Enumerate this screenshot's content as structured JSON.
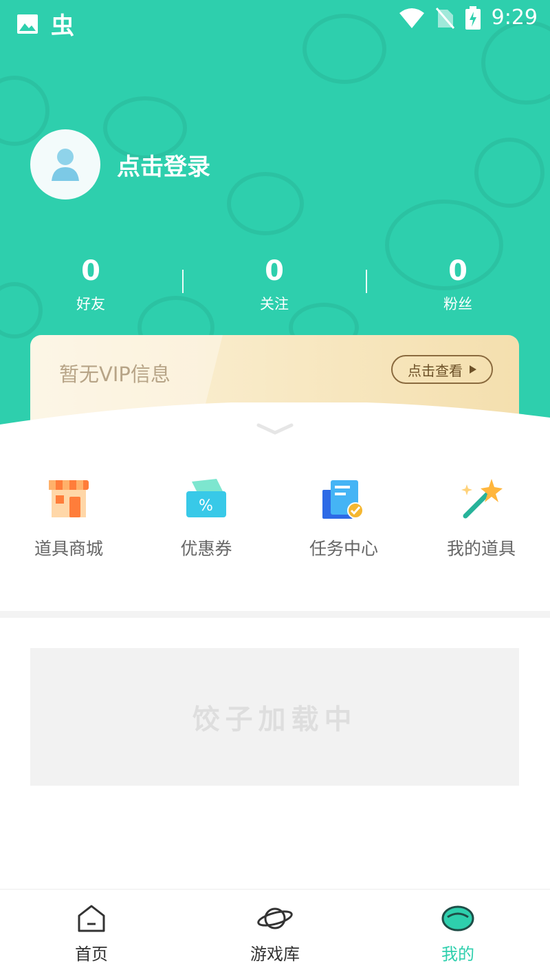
{
  "status_bar": {
    "time": "9:29",
    "app_glyph": "虫"
  },
  "profile": {
    "login_text": "点击登录"
  },
  "stats": [
    {
      "value": "0",
      "label": "好友"
    },
    {
      "value": "0",
      "label": "关注"
    },
    {
      "value": "0",
      "label": "粉丝"
    }
  ],
  "vip": {
    "text": "暂无VIP信息",
    "button_label": "点击查看"
  },
  "quick_menu": [
    {
      "label": "道具商城",
      "icon": "shop-icon"
    },
    {
      "label": "优惠券",
      "icon": "coupon-icon"
    },
    {
      "label": "任务中心",
      "icon": "task-icon"
    },
    {
      "label": "我的道具",
      "icon": "magic-wand-icon"
    }
  ],
  "banner": {
    "text": "饺子加载中"
  },
  "tabbar": {
    "items": [
      {
        "label": "首页",
        "icon": "home-icon"
      },
      {
        "label": "游戏库",
        "icon": "planet-icon"
      },
      {
        "label": "我的",
        "icon": "mine-icon",
        "active": true
      }
    ],
    "active_color": "#2ecfad"
  },
  "colors": {
    "header": "#2ecfad",
    "vip_bg": "#f9ebc9"
  }
}
